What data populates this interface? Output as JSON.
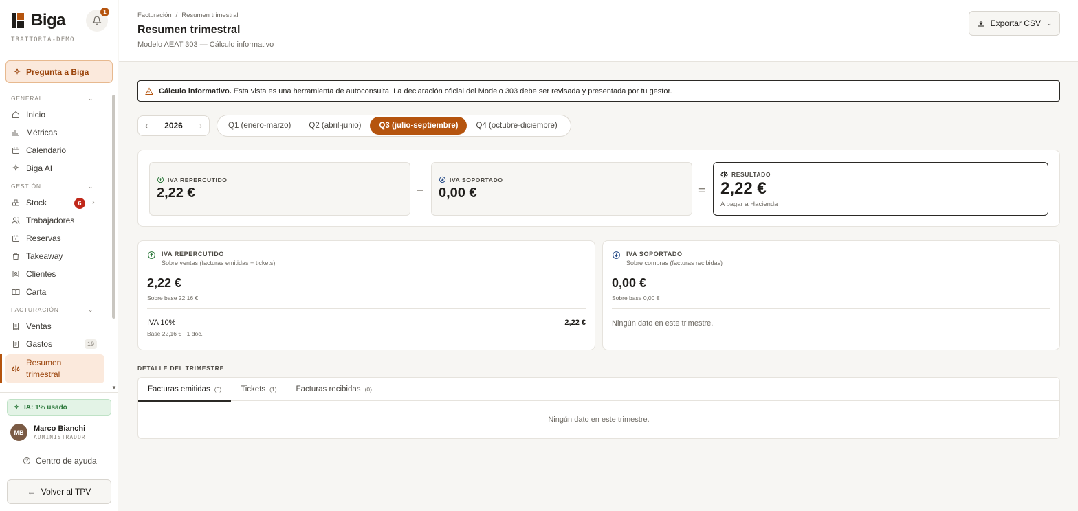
{
  "brand": {
    "name": "Biga",
    "org": "TRATTORIA-DEMO",
    "notifications": "1"
  },
  "ask_button": "Pregunta a Biga",
  "sidebar": {
    "sections": [
      {
        "label": "GENERAL",
        "items": [
          "Inicio",
          "Métricas",
          "Calendario",
          "Biga AI"
        ]
      },
      {
        "label": "GESTIÓN",
        "items": [
          "Stock",
          "Trabajadores",
          "Reservas",
          "Takeaway",
          "Clientes",
          "Carta"
        ],
        "stock_badge": "6"
      },
      {
        "label": "FACTURACIÓN",
        "items": [
          "Ventas",
          "Gastos",
          "Resumen trimestral"
        ],
        "gastos_count": "19"
      }
    ],
    "ai_usage": "IA: 1% usado",
    "user": {
      "initials": "MB",
      "name": "Marco Bianchi",
      "role": "ADMINISTRADOR"
    },
    "help": "Centro de ayuda",
    "back": "Volver al TPV"
  },
  "header": {
    "breadcrumb": [
      "Facturación",
      "/",
      "Resumen trimestral"
    ],
    "title": "Resumen trimestral",
    "subtitle": "Modelo AEAT 303 — Cálculo informativo",
    "export": "Exportar CSV"
  },
  "notice": {
    "bold": "Cálculo informativo.",
    "text": " Esta vista es una herramienta de autoconsulta. La declaración oficial del Modelo 303 debe ser revisada y presentada por tu gestor."
  },
  "year": "2026",
  "quarters": [
    "Q1 (enero-marzo)",
    "Q2 (abril-junio)",
    "Q3 (julio-septiembre)",
    "Q4 (octubre-diciembre)"
  ],
  "active_quarter": 2,
  "summary": {
    "repercutido": {
      "label": "IVA REPERCUTIDO",
      "value": "2,22 €"
    },
    "minus": "−",
    "soportado": {
      "label": "IVA SOPORTADO",
      "value": "0,00 €"
    },
    "equals": "=",
    "resultado": {
      "label": "RESULTADO",
      "value": "2,22 €",
      "note": "A pagar a Hacienda"
    }
  },
  "cards": {
    "repercutido": {
      "title": "IVA REPERCUTIDO",
      "sub": "Sobre ventas (facturas emitidas + tickets)",
      "value": "2,22 €",
      "base": "Sobre base 22,16 €",
      "row": {
        "label": "IVA 10%",
        "sub": "Base 22,16 € · 1 doc.",
        "amount": "2,22 €"
      }
    },
    "soportado": {
      "title": "IVA SOPORTADO",
      "sub": "Sobre compras (facturas recibidas)",
      "value": "0,00 €",
      "base": "Sobre base 0,00 €",
      "empty": "Ningún dato en este trimestre."
    }
  },
  "detail": {
    "title": "DETALLE DEL TRIMESTRE",
    "tabs": [
      {
        "label": "Facturas emitidas",
        "count": "(0)"
      },
      {
        "label": "Tickets",
        "count": "(1)"
      },
      {
        "label": "Facturas recibidas",
        "count": "(0)"
      }
    ],
    "empty": "Ningún dato en este trimestre."
  },
  "colors": {
    "accent": "#b5540e",
    "accent_soft": "#fbe9dc",
    "danger": "#c0281a",
    "success": "#2f7a3e"
  }
}
